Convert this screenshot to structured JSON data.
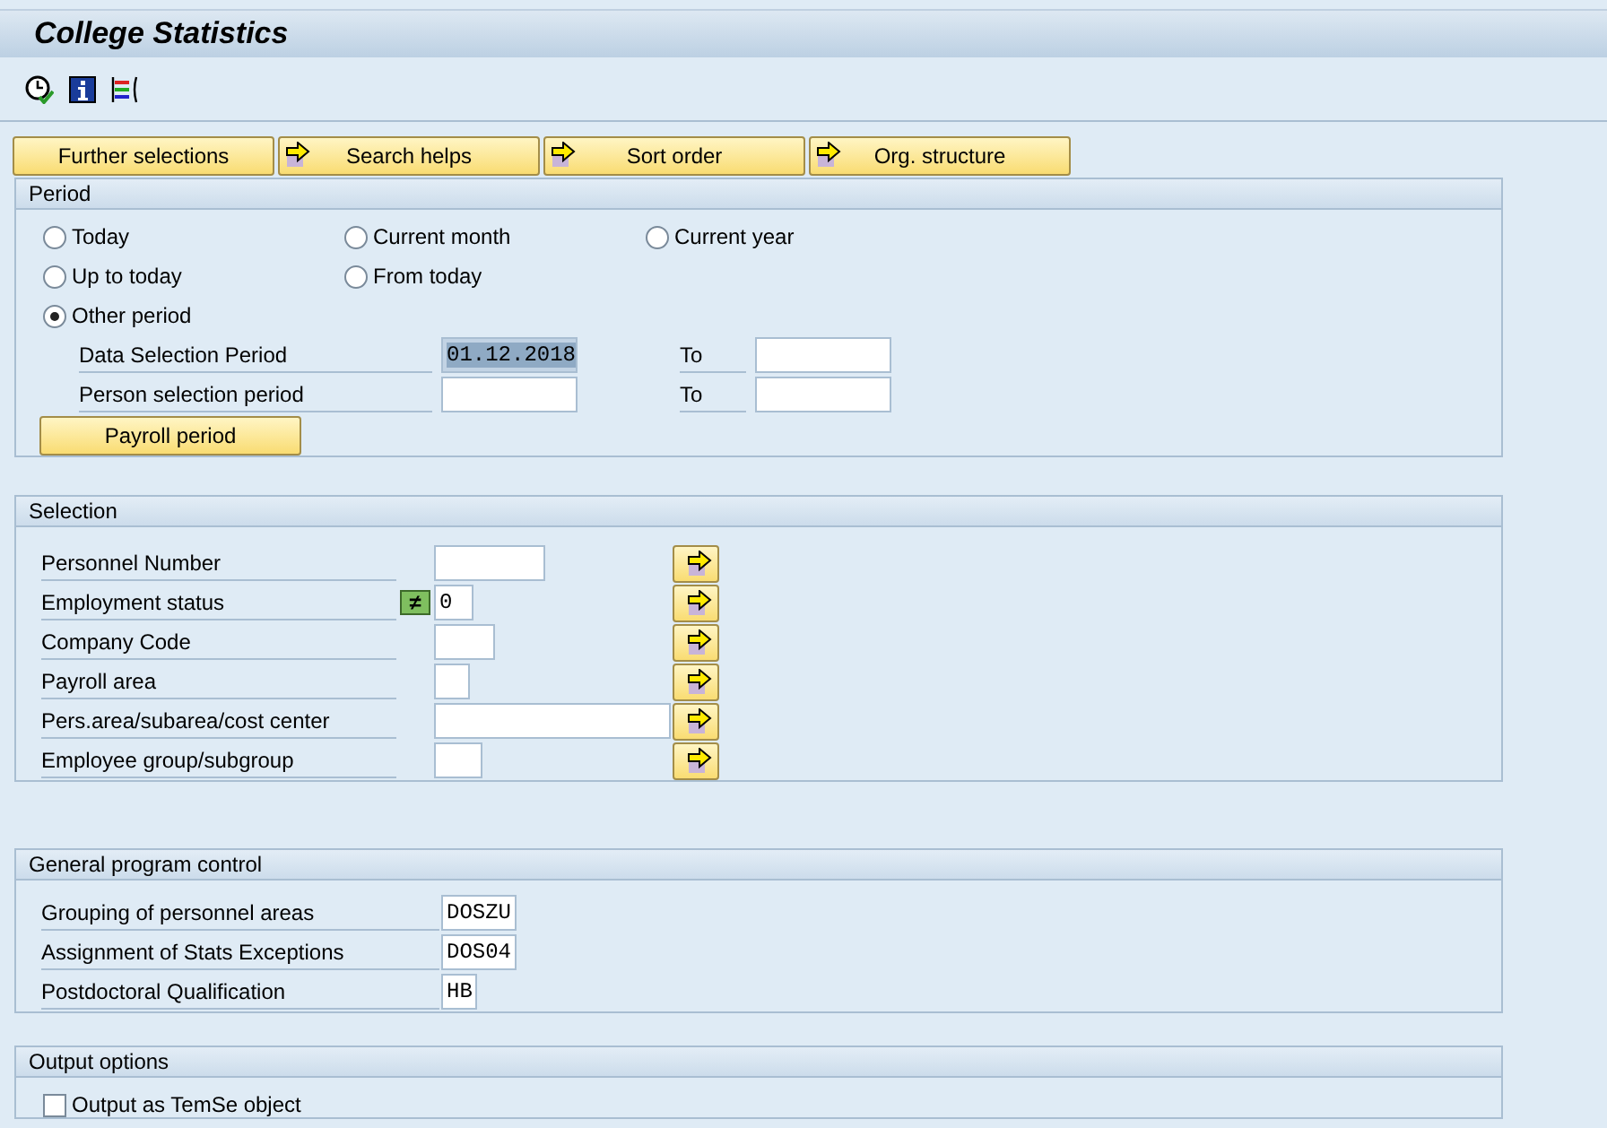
{
  "window": {
    "title": "College Statistics"
  },
  "toolbar": {
    "icons": [
      {
        "kind": "execute"
      },
      {
        "kind": "info"
      },
      {
        "kind": "variant"
      }
    ]
  },
  "tab_buttons": [
    {
      "label": "Further selections",
      "arrow": false
    },
    {
      "label": "Search helps",
      "arrow": true
    },
    {
      "label": "Sort order",
      "arrow": true
    },
    {
      "label": "Org. structure",
      "arrow": true
    }
  ],
  "period": {
    "title": "Period",
    "options": [
      {
        "label": "Today",
        "selected": false
      },
      {
        "label": "Current month",
        "selected": false
      },
      {
        "label": "Current year",
        "selected": false
      },
      {
        "label": "Up to today",
        "selected": false
      },
      {
        "label": "From today",
        "selected": false
      },
      {
        "label": "Other period",
        "selected": true
      }
    ],
    "fields": [
      {
        "label": "Data Selection Period",
        "value": "01.12.2018",
        "to_label": "To"
      },
      {
        "label": "Person selection period",
        "to_label": "To"
      }
    ],
    "button": "Payroll period"
  },
  "selection": {
    "title": "Selection",
    "fields": [
      {
        "label": "Personnel Number"
      },
      {
        "label": "Employment status",
        "option": "≠",
        "value": "0"
      },
      {
        "label": "Company Code"
      },
      {
        "label": "Payroll area"
      },
      {
        "label": "Pers.area/subarea/cost center"
      },
      {
        "label": "Employee group/subgroup"
      }
    ]
  },
  "program_control": {
    "title": "General program control",
    "fields": [
      {
        "label": "Grouping of personnel areas",
        "value": "DOSZU"
      },
      {
        "label": "Assignment of Stats Exceptions",
        "value": "DOS04"
      },
      {
        "label": "Postdoctoral Qualification",
        "value": "HB"
      }
    ]
  },
  "output_options": {
    "title": "Output options",
    "checkbox": {
      "label": "Output as TemSe object",
      "checked": false
    }
  }
}
